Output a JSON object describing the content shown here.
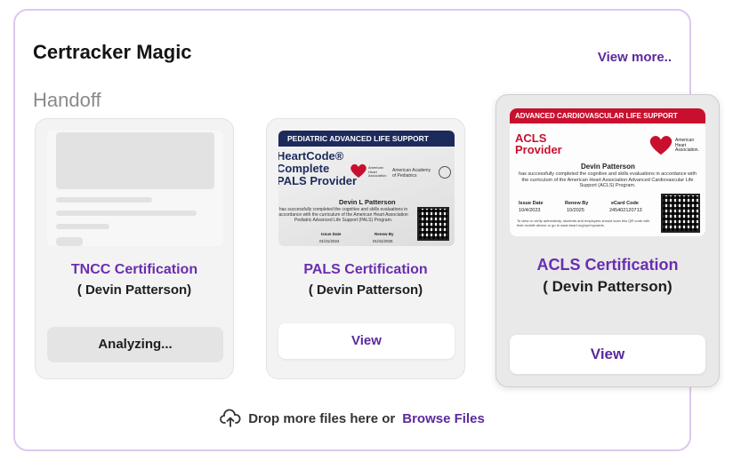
{
  "header": {
    "title": "Certracker Magic",
    "view_more": "View more.."
  },
  "section_label": "Handoff",
  "cards": [
    {
      "name": "TNCC Certification",
      "holder": "( Devin Patterson)",
      "action": "Analyzing..."
    },
    {
      "name": "PALS Certification",
      "holder": "( Devin Patterson)",
      "action": "View",
      "image": {
        "banner": "PEDIATRIC ADVANCED LIFE SUPPORT",
        "line1": "HeartCode®",
        "line2": "Complete",
        "line3": "PALS Provider",
        "aha": "American Heart Association",
        "aap": "American Academy of Pediatrics",
        "person": "Devin L Patterson",
        "body": "has successfully completed the cognitive and skills evaluations in accordance with the curriculum of the American Heart Association Pediatric Advanced Life Support (PALS) Program.",
        "issue_label": "Issue Date",
        "renew_label": "Renew By",
        "issue": "01/31/2024",
        "renew": "01/31/2026"
      }
    },
    {
      "name": "ACLS Certification",
      "holder": "( Devin Patterson)",
      "action": "View",
      "image": {
        "banner": "ADVANCED CARDIOVASCULAR LIFE SUPPORT",
        "title1": "ACLS",
        "title2": "Provider",
        "aha": "American Heart Association.",
        "person": "Devin Patterson",
        "body": "has successfully completed the cognitive and skills evaluations in accordance with the curriculum of the American Heart Association Advanced Cardiovascular Life Support (ACLS) Program.",
        "issue_label": "Issue Date",
        "renew_label": "Renew By",
        "ecard_label": "eCard Code",
        "issue": "10/4/2023",
        "renew": "10/2025",
        "ecard": "245402120713",
        "footer": "To view or verify authenticity, students and employers should scan this QR code with their mobile device or go to www.heart.org/cpr/mycards."
      }
    }
  ],
  "dropzone": {
    "text": "Drop more files here or",
    "browse": "Browse Files"
  },
  "colors": {
    "accent": "#5b2a9c",
    "cert_name": "#6a2db0",
    "border": "#dcc8f0",
    "acls_red": "#c8102e",
    "pals_navy": "#1d2b5c"
  }
}
